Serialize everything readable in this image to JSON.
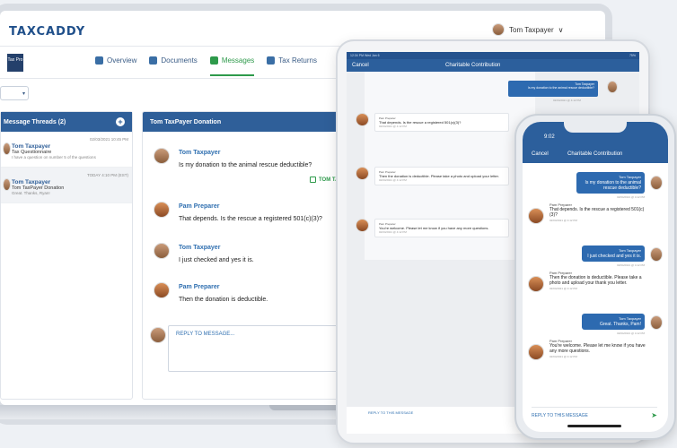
{
  "app": {
    "logo_text": "TAXCADDY",
    "firm_logo": "Tax Pro"
  },
  "user": {
    "name": "Tom Taxpayer",
    "menu_caret": "∨"
  },
  "nav": {
    "tabs": [
      {
        "label": "Overview",
        "icon": "home-icon"
      },
      {
        "label": "Documents",
        "icon": "documents-icon"
      },
      {
        "label": "Messages",
        "icon": "messages-icon",
        "active": true
      },
      {
        "label": "Tax Returns",
        "icon": "tax-returns-icon"
      }
    ]
  },
  "year_select": {
    "value": "▾"
  },
  "threads": {
    "title": "Message Threads (2)",
    "add": "+",
    "items": [
      {
        "date": "02/03/2021  10:45 PM",
        "name": "Tom Taxpayer",
        "subject": "Tax Questionnaire",
        "preview": "I have a question on number 5 of the questions"
      },
      {
        "date": "TODAY  4:10 PM  (EST)",
        "name": "Tom Taxpayer",
        "subject": "Tom TaxPayer Donation",
        "preview": "Great. Thanks, Ryan!"
      }
    ]
  },
  "conversation": {
    "title": "Tom TaxPayer Donation",
    "attachment": "TOM TA",
    "messages": [
      {
        "name": "Tom Taxpayer",
        "text": "Is my donation to the animal rescue deductible?"
      },
      {
        "name": "Pam Preparer",
        "text": "That depends. Is the rescue a registered 501(c)(3)?"
      },
      {
        "name": "Tom Taxpayer",
        "text": "I just checked and yes it is."
      },
      {
        "name": "Pam Preparer",
        "text": "Then the donation is deductible."
      }
    ],
    "reply_placeholder": "REPLY TO MESSAGE..."
  },
  "tablet": {
    "status_left": "12:34 PM Wed Jan 6",
    "status_right": "75%",
    "cancel": "Cancel",
    "title": "Charitable Contribution",
    "right_bubble": {
      "who": "Tom Taxpayer",
      "text": "Is my donation to the animal rescue deductible?"
    },
    "right_time": "02/04/2021 @ 4:12 PM",
    "messages": [
      {
        "from": "Pam Preparer",
        "text": "That depends. Is the rescue a registered 501(c)(3)?",
        "time": "02/04/2021 @ 4:12 PM"
      },
      {
        "from": "Pam Preparer",
        "text": "Then the donation is deductible. Please take a photo and upload your letter.",
        "time": "02/04/2021 @ 4:12 PM"
      },
      {
        "from": "Pam Preparer",
        "text": "You're welcome. Please let me know if you have any more questions.",
        "time": "02/04/2021 @ 4:12 PM"
      }
    ],
    "reply": "REPLY TO THIS MESSAGE"
  },
  "phone": {
    "time": "9:02",
    "cancel": "Cancel",
    "title": "Charitable Contribution",
    "right_bubbles": [
      {
        "who": "Tom Taxpayer",
        "text": "Is my donation to the animal rescue deductible?",
        "time": "02/04/2021 @ 4:12 PM"
      },
      {
        "who": "Tom Taxpayer",
        "text": "I just checked and yes it is.",
        "time": "02/04/2021 @ 4:12 PM"
      },
      {
        "who": "Tom Taxpayer",
        "text": "Great. Thanks, Pam!",
        "time": "02/04/2021 @ 4:12 PM"
      }
    ],
    "left_messages": [
      {
        "from": "Pam Preparer",
        "text": "That depends. Is the rescue a registered 501(c)(3)?",
        "time": "02/04/2021 @ 4:12 PM"
      },
      {
        "from": "Pam Preparer",
        "text": "Then the donation is deductible. Please take a photo and upload your thank you letter.",
        "time": "02/04/2021 @ 4:12 PM"
      },
      {
        "from": "Pam Preparer",
        "text": "You're welcome. Please let me know if you have any more questions.",
        "time": "02/04/2021 @ 4:12 PM"
      }
    ],
    "reply": "REPLY TO THIS MESSAGE",
    "send": "➤"
  },
  "colors": {
    "brand": "#2f5f99",
    "accent": "#2e9a4b",
    "bubble": "#2d6ab0"
  }
}
